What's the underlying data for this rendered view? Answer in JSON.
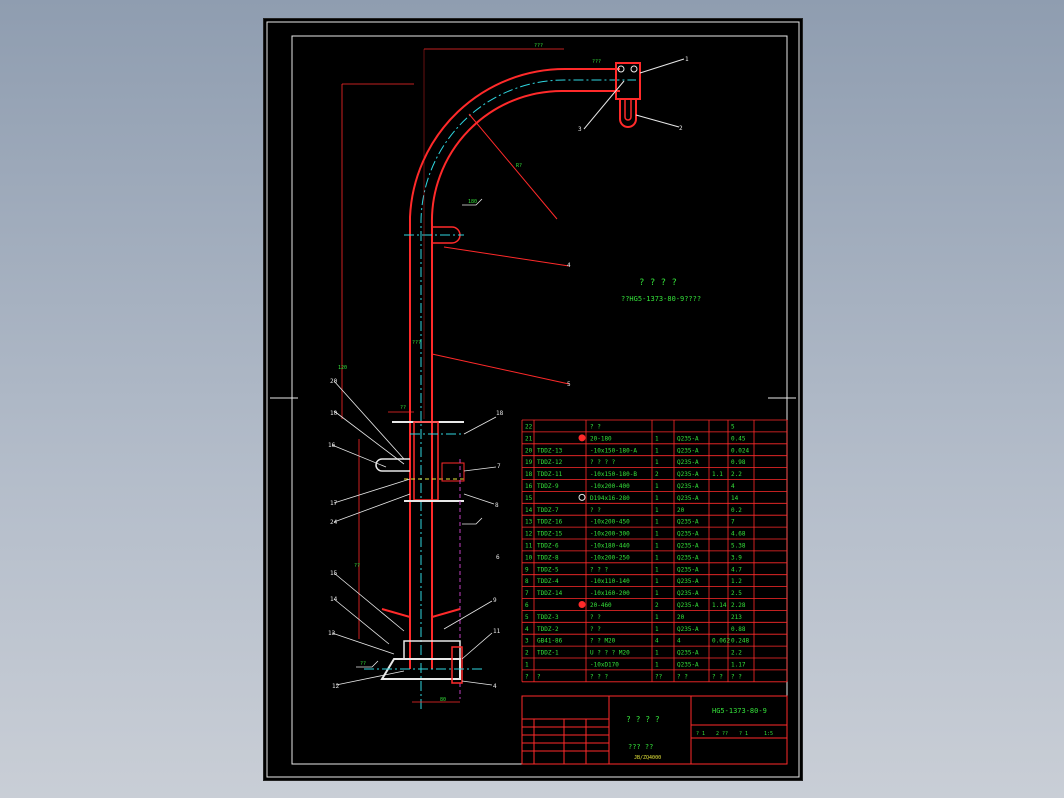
{
  "drawing": {
    "title_cn": "? ? ? ?",
    "subtitle_cn": "??HG5-1373-80-9????",
    "drawing_no": "HG5-1373-80-9",
    "block_title_cn": "? ? ? ?",
    "block_subtitle_cn": "??? ??",
    "block_code": "JB/ZQ4000",
    "block_sheet_a": "? 1",
    "block_sheet_b": "2 ??",
    "block_sheet_c": "? 1",
    "block_sheet_d": "1:5"
  },
  "balloons": {
    "b1": "1",
    "b2": "3",
    "b3": "2",
    "b4": "4",
    "b5": "5",
    "b6": "6",
    "b20": "20",
    "b10": "10",
    "b16": "16",
    "b17": "17",
    "b18": "18",
    "b24": "24",
    "b7": "7",
    "b8": "8",
    "b15": "15",
    "b14": "14",
    "b13": "13",
    "b12": "12",
    "b9": "9",
    "b11": "11"
  },
  "dims": {
    "d1": "???",
    "d2": "???",
    "d3": "R?",
    "d4": "120",
    "d5": "??",
    "d6": "??",
    "d7": "80",
    "d8": "???",
    "d9": "180",
    "d10": "??"
  },
  "bom": {
    "header": [
      "22",
      "",
      "? ?",
      "",
      "",
      "",
      "5"
    ],
    "rows": [
      [
        "21",
        "",
        "20-180",
        "1",
        "Q235-A",
        "",
        "0.45"
      ],
      [
        "20",
        "TDDZ-13",
        "-10x150-180-A",
        "1",
        "Q235-A",
        "",
        "0.024"
      ],
      [
        "19",
        "TDDZ-12",
        "? ? ? ?",
        "1",
        "Q235-A",
        "",
        "0.98"
      ],
      [
        "18",
        "TDDZ-11",
        "-10x150-180-B",
        "2",
        "Q235-A",
        "1.1",
        "2.2"
      ],
      [
        "16",
        "TDDZ-9",
        "-10x200-400",
        "1",
        "Q235-A",
        "",
        "4"
      ],
      [
        "15",
        "",
        "D194x16-280",
        "1",
        "Q235-A",
        "",
        "14"
      ],
      [
        "14",
        "TDDZ-7",
        "? ?",
        "1",
        "20",
        "",
        "0.2"
      ],
      [
        "13",
        "TDDZ-16",
        "-10x200-450",
        "1",
        "Q235-A",
        "",
        "7"
      ],
      [
        "12",
        "TDDZ-15",
        "-10x200-300",
        "1",
        "Q235-A",
        "",
        "4.68"
      ],
      [
        "11",
        "TDDZ-6",
        "-10x180-440",
        "1",
        "Q235-A",
        "",
        "5.38"
      ],
      [
        "10",
        "TDDZ-8",
        "-10x200-250",
        "1",
        "Q235-A",
        "",
        "3.9"
      ],
      [
        "9",
        "TDDZ-5",
        "? ? ?",
        "1",
        "Q235-A",
        "",
        "4.7"
      ],
      [
        "8",
        "TDDZ-4",
        "-10x110-140",
        "1",
        "Q235-A",
        "",
        "1.2"
      ],
      [
        "7",
        "TDDZ-14",
        "-10x160-200",
        "1",
        "Q235-A",
        "",
        "2.5"
      ],
      [
        "6",
        "",
        "20-460",
        "2",
        "Q235-A",
        "1.14",
        "2.28"
      ],
      [
        "5",
        "TDDZ-3",
        "? ?",
        "1",
        "20",
        "",
        "213"
      ],
      [
        "4",
        "TDDZ-2",
        "? ?",
        "1",
        "Q235-A",
        "",
        "0.88"
      ],
      [
        "3",
        "GB41-86",
        "? ? M20",
        "4",
        "4",
        "0.062",
        "0.248"
      ],
      [
        "2",
        "TDDZ-1",
        "U ? ? ? M20",
        "1",
        "Q235-A",
        "",
        "2.2"
      ],
      [
        "1",
        "",
        "-10xD170",
        "1",
        "Q235-A",
        "",
        "1.17"
      ]
    ],
    "footer": [
      "?",
      "?",
      "? ? ?",
      "??",
      "? ?",
      "? ?",
      "? ?"
    ]
  },
  "colors": {
    "sheet": "#000000",
    "pipe": "#ff2a2a",
    "centerline": "#2fd6e0",
    "text": "#34e13a",
    "markers": "#ff2a2a"
  }
}
